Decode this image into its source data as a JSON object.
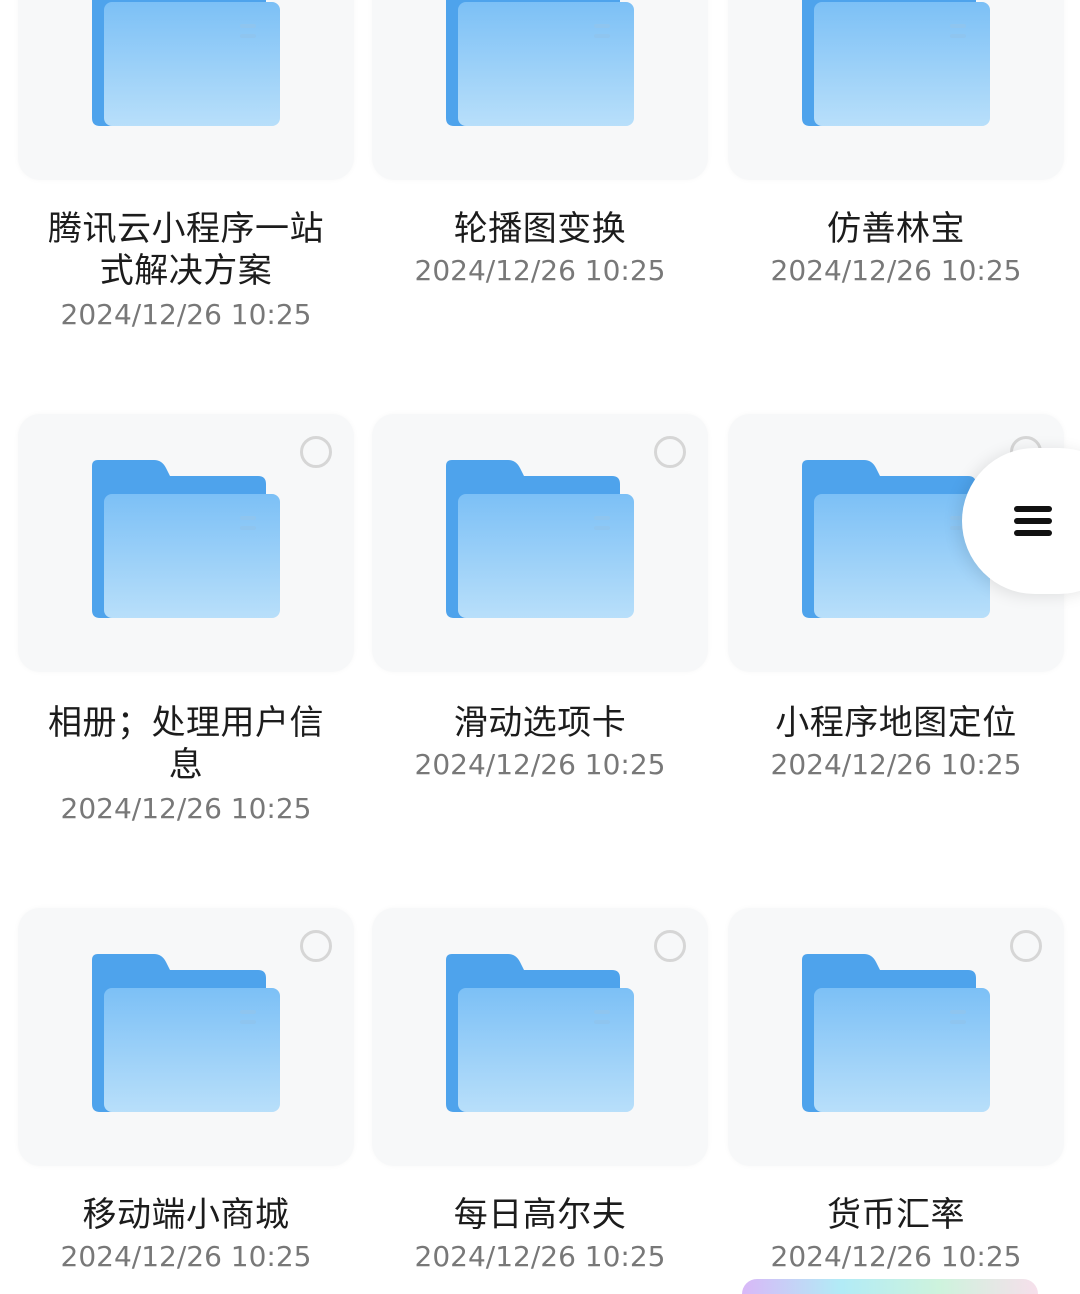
{
  "colors": {
    "folder_back": "#4ea3ec",
    "folder_front_top": "#7cc0f6",
    "folder_front_bottom": "#b8dffa",
    "folder_edge": "#4fa4ed",
    "card_bg": "#f7f8f9",
    "select_border": "#d6d6d6"
  },
  "folders": [
    {
      "name": "腾讯云小程序一站式解决方案",
      "name_lines": [
        "腾讯云小程序一站",
        "式解决方案"
      ],
      "date": "2024/12/26 10:25",
      "icon": "folder-icon",
      "selectable": false
    },
    {
      "name": "轮播图变换",
      "name_lines": [
        "轮播图变换"
      ],
      "date": "2024/12/26 10:25",
      "icon": "folder-icon",
      "selectable": false
    },
    {
      "name": "仿善林宝",
      "name_lines": [
        "仿善林宝"
      ],
      "date": "2024/12/26 10:25",
      "icon": "folder-icon",
      "selectable": false
    },
    {
      "name": "相册；处理用户信息",
      "name_lines": [
        "相册；处理用户信",
        "息"
      ],
      "date": "2024/12/26 10:25",
      "icon": "folder-icon",
      "selectable": true
    },
    {
      "name": "滑动选项卡",
      "name_lines": [
        "滑动选项卡"
      ],
      "date": "2024/12/26 10:25",
      "icon": "folder-icon",
      "selectable": true
    },
    {
      "name": "小程序地图定位",
      "name_lines": [
        "小程序地图定位"
      ],
      "date": "2024/12/26 10:25",
      "icon": "folder-icon",
      "selectable": true
    },
    {
      "name": "移动端小商城",
      "name_lines": [
        "移动端小商城"
      ],
      "date": "2024/12/26 10:25",
      "icon": "folder-icon",
      "selectable": true
    },
    {
      "name": "每日高尔夫",
      "name_lines": [
        "每日高尔夫"
      ],
      "date": "2024/12/26 10:25",
      "icon": "folder-icon",
      "selectable": true
    },
    {
      "name": "货币汇率",
      "name_lines": [
        "货币汇率"
      ],
      "date": "2024/12/26 10:25",
      "icon": "folder-icon",
      "selectable": true
    }
  ],
  "floating_menu": {
    "icon": "menu-icon"
  }
}
